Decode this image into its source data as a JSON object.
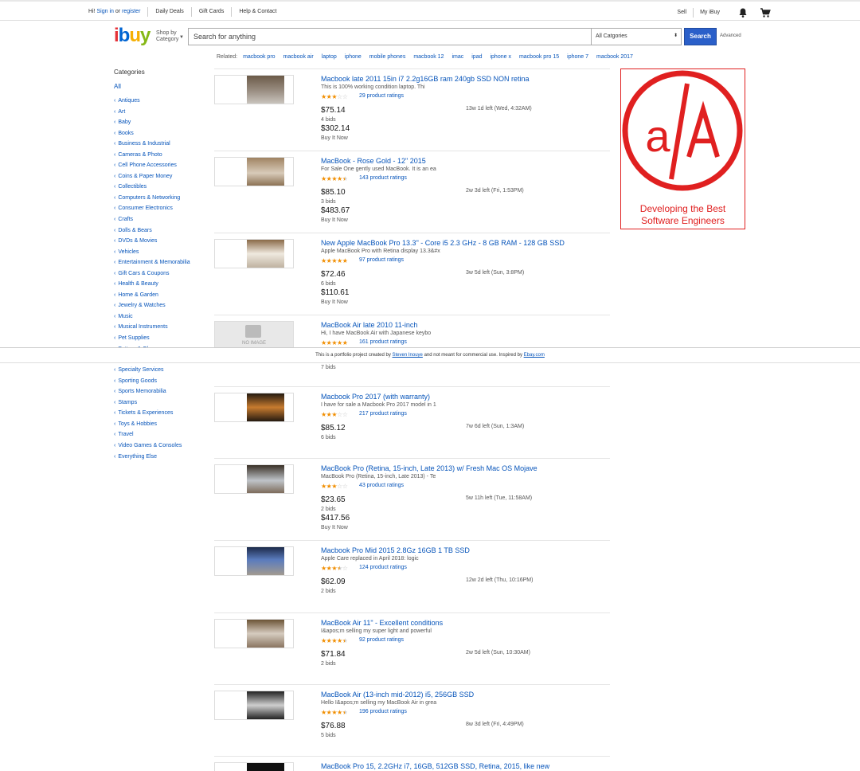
{
  "topnav": {
    "greeting": "Hi!",
    "sign_in": "Sign in",
    "or": "or",
    "register": "register",
    "links": [
      "Daily Deals",
      "Gift Cards",
      "Help & Contact"
    ],
    "right_links": [
      "Sell",
      "My iBuy"
    ]
  },
  "header": {
    "logo": [
      "i",
      "b",
      "u",
      "y"
    ],
    "shop_by": "Shop by",
    "category": "Category",
    "search_placeholder": "Search for anything",
    "category_select": "All Catgories",
    "search_button": "Search",
    "advanced": "Advanced"
  },
  "related": {
    "label": "Related:",
    "items": [
      "macbook pro",
      "macbook air",
      "laptop",
      "iphone",
      "mobile phones",
      "macbook 12",
      "imac",
      "ipad",
      "iphone x",
      "macbook pro 15",
      "iphone 7",
      "macbook 2017"
    ]
  },
  "sidebar": {
    "title": "Categories",
    "all": "All",
    "categories": [
      "Antiques",
      "Art",
      "Baby",
      "Books",
      "Business & Industrial",
      "Cameras & Photo",
      "Cell Phone Accessories",
      "Coins & Paper Money",
      "Collectibles",
      "Computers & Networking",
      "Consumer Electronics",
      "Crafts",
      "Dolls & Bears",
      "DVDs & Movies",
      "Vehicles",
      "Entertainment & Memorabilia",
      "Gift Cars & Coupons",
      "Health & Beauty",
      "Home & Garden",
      "Jewelry & Watches",
      "Music",
      "Musical Instruments",
      "Pet Supplies",
      "Pottery & Glass"
    ],
    "categories_after": [
      "Specialty Services",
      "Sporting Goods",
      "Sports Memorabilia",
      "Stamps",
      "Tickets & Experiences",
      "Toys & Hobbies",
      "Travel",
      "Video Games & Consoles",
      "Everything Else"
    ]
  },
  "listings": [
    {
      "title": "Macbook late 2011 15in i7 2.2g16GB ram 240gb SSD NON retina",
      "subtitle": "This is 100% working condition laptop. Thi",
      "stars": 3,
      "ratings": "29 product ratings",
      "price": "$75.14",
      "bids": "4 bids",
      "time_left": "13w 1d left (Wed, 4:32AM)",
      "bin_price": "$302.14",
      "bin_label": "Buy It Now"
    },
    {
      "title": "MacBook - Rose Gold - 12\" 2015",
      "subtitle": "For Sale One gently used MacBook. It is an ea",
      "stars": 4.5,
      "ratings": "143 product ratings",
      "price": "$85.10",
      "bids": "3 bids",
      "time_left": "2w 3d left (Fri, 1:53PM)",
      "bin_price": "$483.67",
      "bin_label": "Buy It Now"
    },
    {
      "title": "New Apple MacBook Pro 13.3\" - Core i5 2.3 GHz - 8 GB RAM - 128 GB SSD",
      "subtitle": "Apple MacBook Pro with Retina display 13.3&#x",
      "stars": 5,
      "ratings": "97 product ratings",
      "price": "$72.46",
      "bids": "6 bids",
      "time_left": "3w 5d left (Sun, 3:8PM)",
      "bin_price": "$110.61",
      "bin_label": "Buy It Now"
    },
    {
      "title": "MacBook Air late 2010 11-inch",
      "subtitle": "Hi, I have MacBook Air with Japanese keybo",
      "stars": 5,
      "ratings": "161 product ratings",
      "price": "",
      "bids": "7 bids",
      "time_left": "",
      "bin_price": "",
      "bin_label": "",
      "no_image": "NO IMAGE"
    },
    {
      "title": "Macbook Pro 2017 (with warranty)",
      "subtitle": "I have for sale a Macbook Pro 2017 model in 1",
      "stars": 3,
      "ratings": "217 product ratings",
      "price": "$85.12",
      "bids": "6 bids",
      "time_left": "7w 6d left (Sun, 1:3AM)",
      "bin_price": "",
      "bin_label": ""
    },
    {
      "title": "MacBook Pro (Retina, 15-inch, Late 2013) w/ Fresh Mac OS Mojave",
      "subtitle": "MacBook Pro (Retina, 15-inch, Late 2013) - Te",
      "stars": 3,
      "ratings": "43 product ratings",
      "price": "$23.65",
      "bids": "2 bids",
      "time_left": "5w 11h left (Tue, 11:58AM)",
      "bin_price": "$417.56",
      "bin_label": "Buy It Now"
    },
    {
      "title": "Macbook Pro Mid 2015 2.8Gz 16GB 1 TB SSD",
      "subtitle": "Apple Care replaced in April 2018: logic",
      "stars": 3.5,
      "ratings": "124 product ratings",
      "price": "$62.09",
      "bids": "2 bids",
      "time_left": "12w 2d left (Thu, 10:16PM)",
      "bin_price": "",
      "bin_label": ""
    },
    {
      "title": "MacBook Air 11\" - Excellent conditions",
      "subtitle": "I&apos;m selling my super light and powerful",
      "stars": 4.5,
      "ratings": "92 product ratings",
      "price": "$71.84",
      "bids": "2 bids",
      "time_left": "2w 5d left (Sun, 10:30AM)",
      "bin_price": "",
      "bin_label": ""
    },
    {
      "title": "MacBook Air (13-inch mid-2012) i5, 256GB SSD",
      "subtitle": "Hello I&apos;m selling my MacBook Air in grea",
      "stars": 4.5,
      "ratings": "196 product ratings",
      "price": "$76.88",
      "bids": "5 bids",
      "time_left": "8w 3d left (Fri, 4:49PM)",
      "bin_price": "",
      "bin_label": ""
    },
    {
      "title": "MacBook Pro 15, 2.2GHz i7, 16GB, 512GB SSD, Retina, 2015, like new",
      "subtitle": "",
      "stars": 0,
      "ratings": "",
      "price": "",
      "bids": "",
      "time_left": "",
      "bin_price": "",
      "bin_label": ""
    }
  ],
  "ad": {
    "logo_text": "a/A",
    "tagline_line1": "Developing the Best",
    "tagline_line2": "Software Engineers",
    "color": "#e02020"
  },
  "footer": {
    "text1": "This is a portfolio project created by",
    "author": "Steven Inouye",
    "text2": "and not meant for commercial use. Inspired by",
    "inspired": "Ebay.com"
  },
  "colors": {
    "link": "#0654ba",
    "search_button": "#2a5fc9",
    "star": "#f18e00"
  }
}
